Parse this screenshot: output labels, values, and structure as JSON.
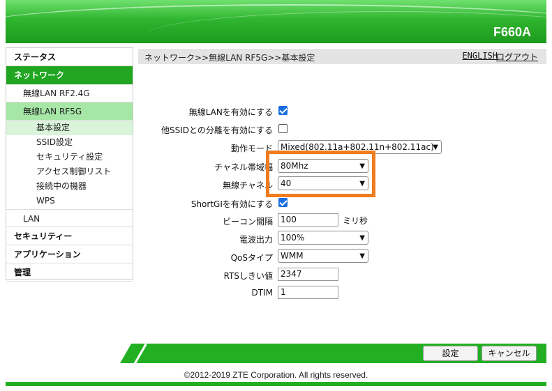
{
  "header": {
    "model": "F660A"
  },
  "sidebar": {
    "status": "ステータス",
    "network": "ネットワーク",
    "wlan24": "無線LAN RF2.4G",
    "wlan5": "無線LAN RF5G",
    "leaves": [
      "基本設定",
      "SSID設定",
      "セキュリティ設定",
      "アクセス制御リスト",
      "接続中の機器",
      "WPS"
    ],
    "lan": "LAN",
    "security": "セキュリティー",
    "application": "アプリケーション",
    "management": "管理"
  },
  "topbar": {
    "breadcrumb": "ネットワーク>>無線LAN RF5G>>基本設定",
    "english": "ENGLISH",
    "logout": "ログアウト"
  },
  "form": {
    "wlan_enable": {
      "label": "無線LANを有効にする",
      "checked": true
    },
    "ssid_isolation": {
      "label": "他SSIDとの分離を有効にする",
      "checked": false
    },
    "mode": {
      "label": "動作モード",
      "value": "Mixed(802.11a+802.11n+802.11ac)"
    },
    "bandwidth": {
      "label": "チャネル帯域幅",
      "value": "80Mhz"
    },
    "channel": {
      "label": "無線チャネル",
      "value": "40"
    },
    "shortgi": {
      "label": "ShortGIを有効にする",
      "checked": true
    },
    "beacon": {
      "label": "ビーコン間隔",
      "value": "100",
      "unit": "ミリ秒"
    },
    "tx_power": {
      "label": "電波出力",
      "value": "100%"
    },
    "qos": {
      "label": "QoSタイプ",
      "value": "WMM"
    },
    "rts": {
      "label": "RTSしきい値",
      "value": "2347"
    },
    "dtim": {
      "label": "DTIM",
      "value": "1"
    }
  },
  "buttons": {
    "apply": "設定",
    "cancel": "キャンセル"
  },
  "footer": {
    "copyright": "©2012-2019 ZTE Corporation. All rights reserved."
  },
  "colors": {
    "brand_green": "#22b022",
    "highlight": "#f07c1f",
    "checkbox_blue": "#1b6fe0"
  }
}
